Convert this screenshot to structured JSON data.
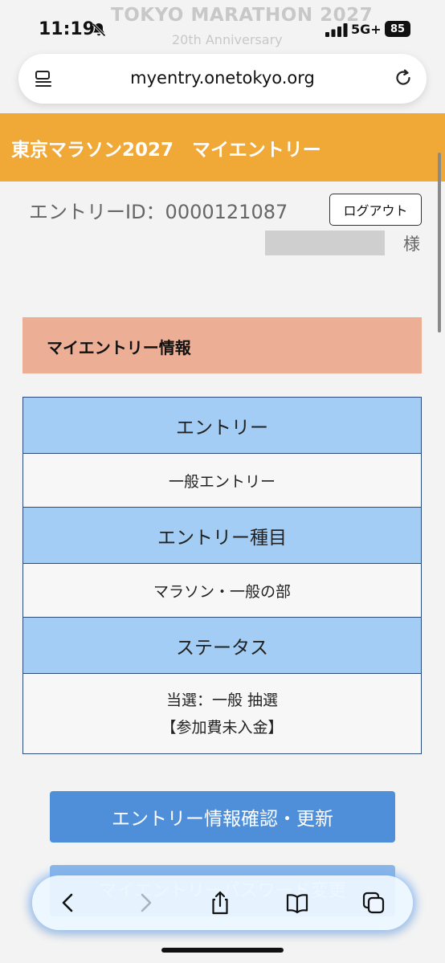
{
  "status_bar": {
    "time": "11:19",
    "network": "5G+",
    "battery": "85",
    "banner_title": "TOKYO MARATHON 2027",
    "banner_subtitle": "20th Anniversary",
    "icons": [
      "bell-slash-icon",
      "signal-bars-icon"
    ]
  },
  "browser": {
    "url": "myentry.onetokyo.org",
    "icons": [
      "page-menu-icon",
      "reload-icon"
    ]
  },
  "site": {
    "header_title": "東京マラソン2027　マイエントリー",
    "accent_color": "#f0a837"
  },
  "account": {
    "entry_id": "エントリーID：0000121087",
    "logout_label": "ログアウト",
    "honorific": "様"
  },
  "section": {
    "title": "マイエントリー情報"
  },
  "entry_table": {
    "entry_heading": "エントリー",
    "entry_value": "一般エントリー",
    "category_heading": "エントリー種目",
    "category_value": "マラソン・一般の部",
    "status_heading": "ステータス",
    "status_value_line1": "当選：一般 抽選",
    "status_value_line2": "【参加費未入金】"
  },
  "actions": {
    "primary_label": "エントリー情報確認・更新",
    "secondary_label": "マイエントリーパスワード変更"
  },
  "toolbar": {
    "icons": [
      "back-icon",
      "forward-icon",
      "share-icon",
      "bookmarks-icon",
      "tabs-icon"
    ]
  }
}
